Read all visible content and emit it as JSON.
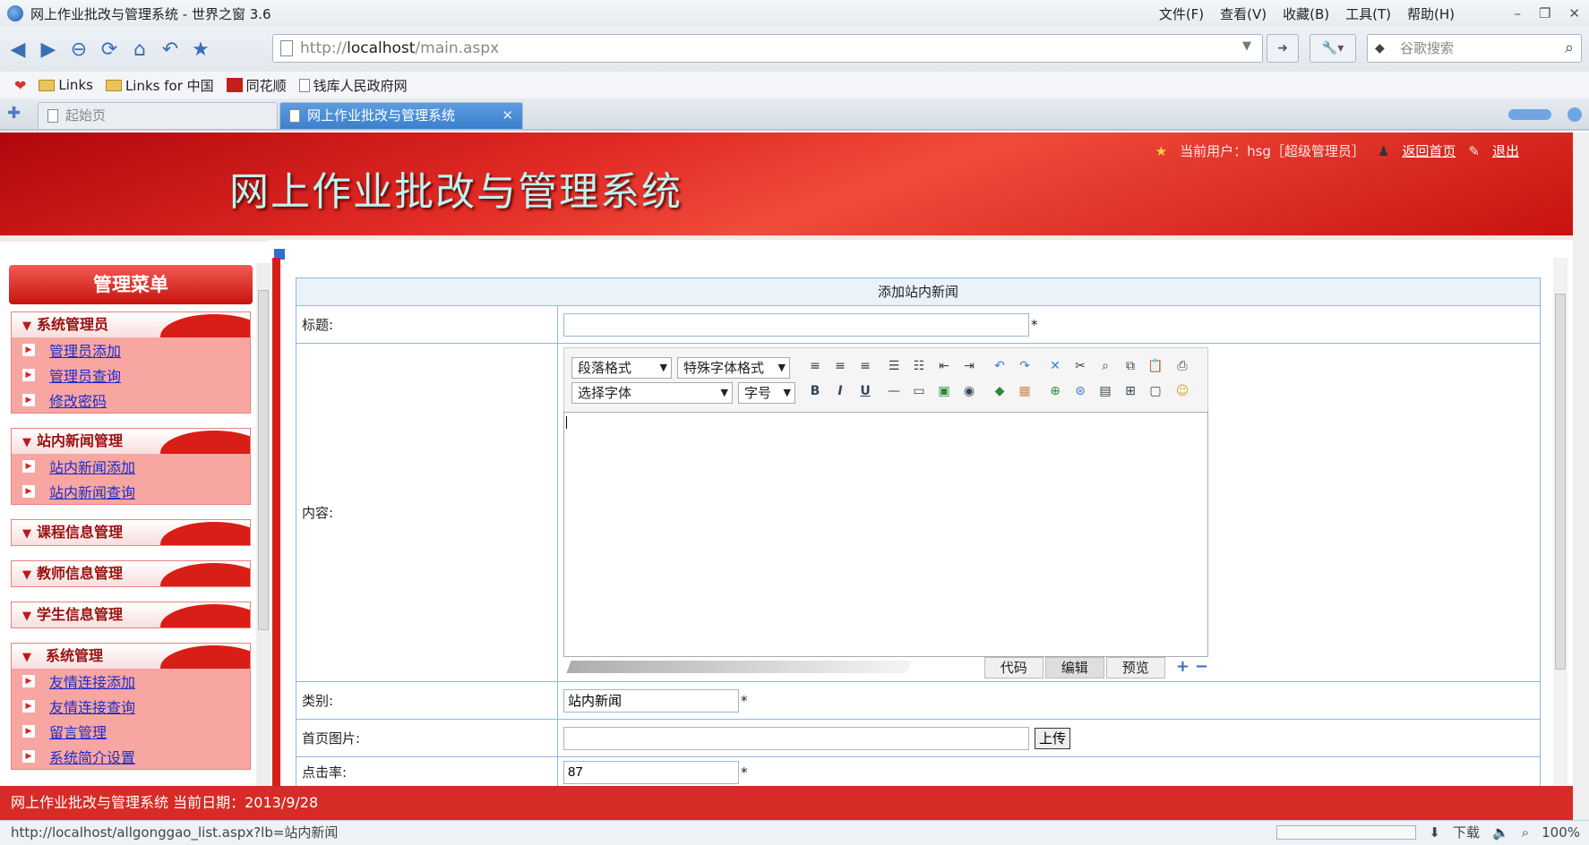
{
  "browser": {
    "window_title": "网上作业批改与管理系统 - 世界之窗 3.6",
    "menus": [
      "文件(F)",
      "查看(V)",
      "收藏(B)",
      "工具(T)",
      "帮助(H)"
    ],
    "url_prefix": "http://",
    "url_host": "localhost",
    "url_path": "/main.aspx",
    "search_placeholder": "谷歌搜索",
    "bookmarks": [
      "Links",
      "Links for 中国",
      "同花顺",
      "钱库人民政府网"
    ],
    "tabs": [
      "起始页",
      "网上作业批改与管理系统"
    ],
    "status_url": "http://localhost/allgonggao_list.aspx?lb=站内新闻",
    "status_download": "下载",
    "zoom": "100%"
  },
  "header": {
    "system_title": "网上作业批改与管理系统",
    "current_user": "当前用户：hsg［超级管理员］",
    "home_link": "返回首页",
    "logout_link": "退出"
  },
  "menu": {
    "title": "管理菜单",
    "groups": [
      {
        "label": "系统管理员",
        "items": [
          "管理员添加",
          "管理员查询",
          "修改密码"
        ]
      },
      {
        "label": "站内新闻管理",
        "items": [
          "站内新闻添加",
          "站内新闻查询"
        ]
      },
      {
        "label": "课程信息管理",
        "items": []
      },
      {
        "label": "教师信息管理",
        "items": []
      },
      {
        "label": "学生信息管理",
        "items": []
      },
      {
        "label": "系统管理",
        "items": [
          "友情连接添加",
          "友情连接查询",
          "留言管理",
          "系统简介设置"
        ]
      }
    ]
  },
  "form": {
    "title": "添加站内新闻",
    "fields": {
      "title_label": "标题:",
      "title_value": "",
      "content_label": "内容:",
      "category_label": "类别:",
      "category_value": "站内新闻",
      "image_label": "首页图片:",
      "image_value": "",
      "upload_label": "上传",
      "clicks_label": "点击率:",
      "clicks_value": "87",
      "required_mark": "*"
    },
    "editor": {
      "paragraph_format": "段落格式",
      "special_format": "特殊字体格式",
      "font_select": "选择字体",
      "font_size": "字号",
      "tab_code": "代码",
      "tab_edit": "编辑",
      "tab_preview": "预览"
    }
  },
  "footer": {
    "text": "网上作业批改与管理系统   当前日期：2013/9/28"
  }
}
